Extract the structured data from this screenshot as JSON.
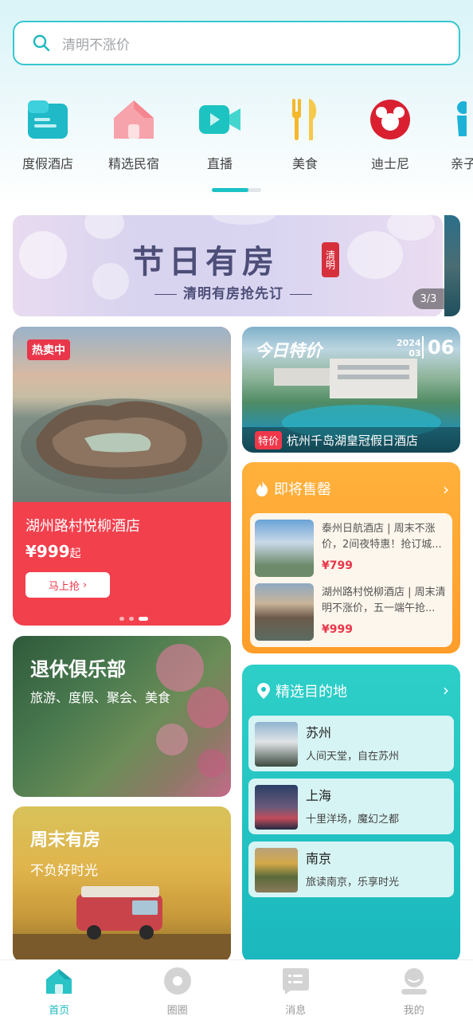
{
  "search": {
    "placeholder": "清明不涨价"
  },
  "categories": [
    {
      "label": "度假酒店",
      "icon": "hotel-card-icon"
    },
    {
      "label": "精选民宿",
      "icon": "house-icon"
    },
    {
      "label": "直播",
      "icon": "video-camera-icon"
    },
    {
      "label": "美食",
      "icon": "fork-knife-icon"
    },
    {
      "label": "迪士尼",
      "icon": "mickey-icon"
    },
    {
      "label": "亲子",
      "icon": "parent-child-icon"
    }
  ],
  "banner": {
    "title": "节日有房",
    "seal": "清明",
    "subtitle": "清明有房抢先订",
    "pager": "3/3"
  },
  "hot": {
    "badge": "热卖中",
    "name": "湖州路村悦柳酒店",
    "price": "¥999",
    "price_suffix": "起",
    "button": "马上抢"
  },
  "today": {
    "title": "今日特价",
    "year": "2024",
    "month": "03",
    "day": "06",
    "tag": "特价",
    "hotel": "杭州千岛湖皇冠假日酒店"
  },
  "sell_out": {
    "title": "即将售罄",
    "items": [
      {
        "desc": "泰州日航酒店 | 周末不涨价，2间夜特惠！抢订城...",
        "price": "¥799"
      },
      {
        "desc": "湖州路村悦柳酒店 | 周末清明不涨价，五一端午抢...",
        "price": "¥999"
      }
    ]
  },
  "club": {
    "title": "退休俱乐部",
    "subtitle": "旅游、度假、聚会、美食"
  },
  "weekend": {
    "title": "周末有房",
    "subtitle": "不负好时光"
  },
  "destinations": {
    "title": "精选目的地",
    "items": [
      {
        "city": "苏州",
        "slogan": "人间天堂，自在苏州"
      },
      {
        "city": "上海",
        "slogan": "十里洋场，魔幻之都"
      },
      {
        "city": "南京",
        "slogan": "旅读南京，乐享时光"
      }
    ]
  },
  "tabbar": [
    {
      "label": "首页",
      "icon": "home-icon",
      "active": true
    },
    {
      "label": "圈圈",
      "icon": "circle-icon",
      "active": false
    },
    {
      "label": "消息",
      "icon": "message-icon",
      "active": false
    },
    {
      "label": "我的",
      "icon": "profile-icon",
      "active": false
    }
  ],
  "colors": {
    "accent": "#1bc2c5",
    "hot": "#f2404d",
    "sell": "#ffa633",
    "dest": "#22c3c3"
  }
}
